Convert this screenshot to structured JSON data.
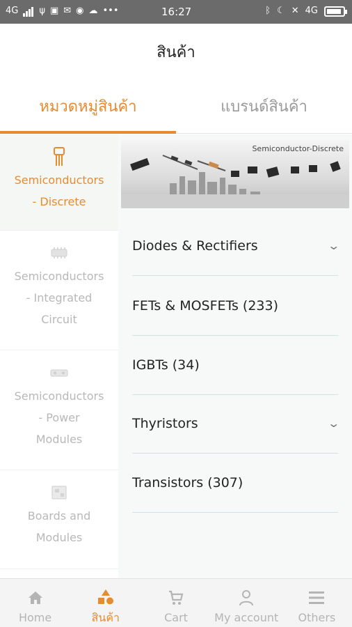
{
  "status_bar": {
    "network_left": "4G",
    "time": "16:27",
    "network_right": "4G",
    "battery_level": 0.9
  },
  "header": {
    "title": "สินค้า"
  },
  "tabs": [
    {
      "label": "หมวดหมู่สินค้า",
      "active": true
    },
    {
      "label": "แบรนด์สินค้า",
      "active": false
    }
  ],
  "categories": [
    {
      "label_line1": "Semiconductors",
      "label_line2": "- Discrete",
      "label_line3": "",
      "icon": "transistor-icon",
      "active": true
    },
    {
      "label_line1": "Semiconductors",
      "label_line2": "- Integrated",
      "label_line3": "Circuit",
      "icon": "ic-chip-icon",
      "active": false
    },
    {
      "label_line1": "Semiconductors",
      "label_line2": "- Power",
      "label_line3": "Modules",
      "icon": "power-module-icon",
      "active": false
    },
    {
      "label_line1": "Boards and",
      "label_line2": "Modules",
      "label_line3": "",
      "icon": "board-icon",
      "active": false
    }
  ],
  "banner": {
    "title": "Semiconductor-Discrete"
  },
  "subcategories": [
    {
      "label": "Diodes & Rectifiers",
      "expandable": true
    },
    {
      "label": "FETs & MOSFETs (233)",
      "expandable": false
    },
    {
      "label": "IGBTs (34)",
      "expandable": false
    },
    {
      "label": "Thyristors",
      "expandable": true
    },
    {
      "label": "Transistors (307)",
      "expandable": false
    }
  ],
  "bottom_nav": [
    {
      "label": "Home",
      "icon": "home-icon",
      "active": false
    },
    {
      "label": "สินค้า",
      "icon": "shapes-icon",
      "active": true
    },
    {
      "label": "Cart",
      "icon": "cart-icon",
      "active": false
    },
    {
      "label": "My account",
      "icon": "user-icon",
      "active": false
    },
    {
      "label": "Others",
      "icon": "menu-icon",
      "active": false
    }
  ],
  "colors": {
    "accent": "#e88a2e",
    "inactive": "#b4b4b4",
    "statusbar": "#6b6b6b"
  }
}
